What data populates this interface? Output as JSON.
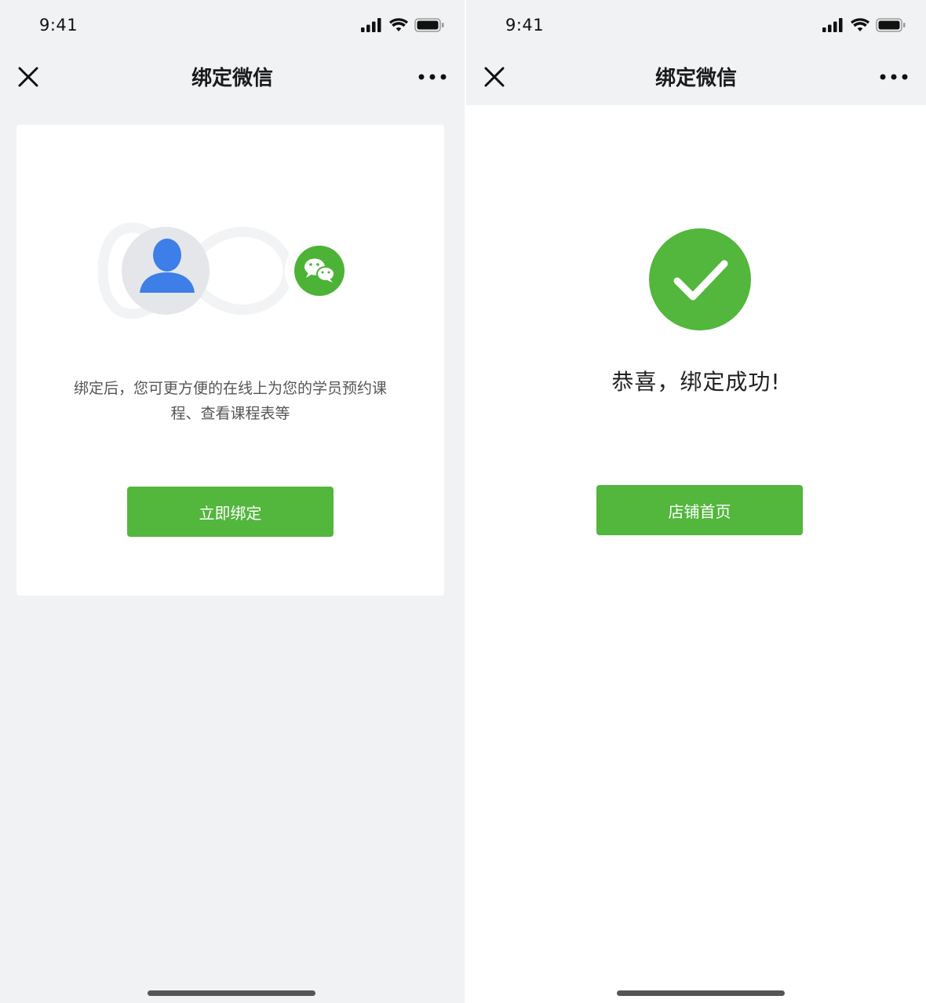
{
  "status_bar": {
    "time": "9:41"
  },
  "left": {
    "nav_title": "绑定微信",
    "description": "绑定后，您可更方便的在线上为您的学员预约课程、查看课程表等",
    "button_label": "立即绑定"
  },
  "right": {
    "nav_title": "绑定微信",
    "success_text": "恭喜，绑定成功!",
    "button_label": "店铺首页"
  },
  "colors": {
    "primary_green": "#53b63d",
    "avatar_blue": "#3d7ee8",
    "background_gray": "#f1f2f4"
  },
  "icons": [
    "close-icon",
    "more-icon",
    "user-icon",
    "wechat-icon",
    "check-icon",
    "signal-icon",
    "wifi-icon",
    "battery-icon"
  ]
}
